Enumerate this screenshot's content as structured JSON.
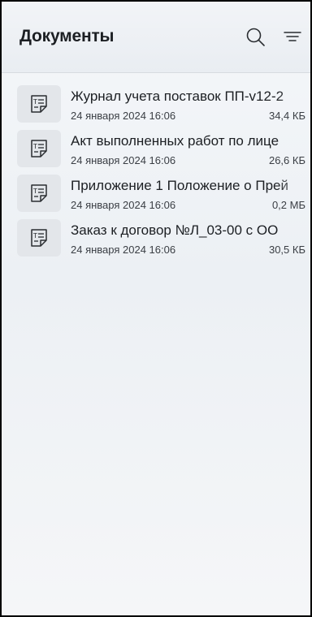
{
  "header": {
    "title": "Документы",
    "icons": {
      "search": "search-icon",
      "filter": "filter-icon"
    }
  },
  "documents": [
    {
      "name": "Журнал учета поставок ПП-v12-2",
      "date": "24 января 2024 16:06",
      "size": "34,4 КБ",
      "icon": "document-icon"
    },
    {
      "name": "Акт выполненных работ по лице",
      "date": "24 января 2024 16:06",
      "size": "26,6 КБ",
      "icon": "document-icon"
    },
    {
      "name": "Приложение 1 Положение о Прей",
      "date": "24 января 2024 16:06",
      "size": "0,2 МБ",
      "icon": "document-icon"
    },
    {
      "name": "Заказ к договор №Л_03-00 с ОО",
      "date": "24 января 2024 16:06",
      "size": "30,5 КБ",
      "icon": "document-icon"
    }
  ],
  "colors": {
    "text": "#1c1f23",
    "secondary_text": "#3a3e44",
    "icon_tile": "#e3e6ea",
    "header_bg": "#eceff3"
  }
}
